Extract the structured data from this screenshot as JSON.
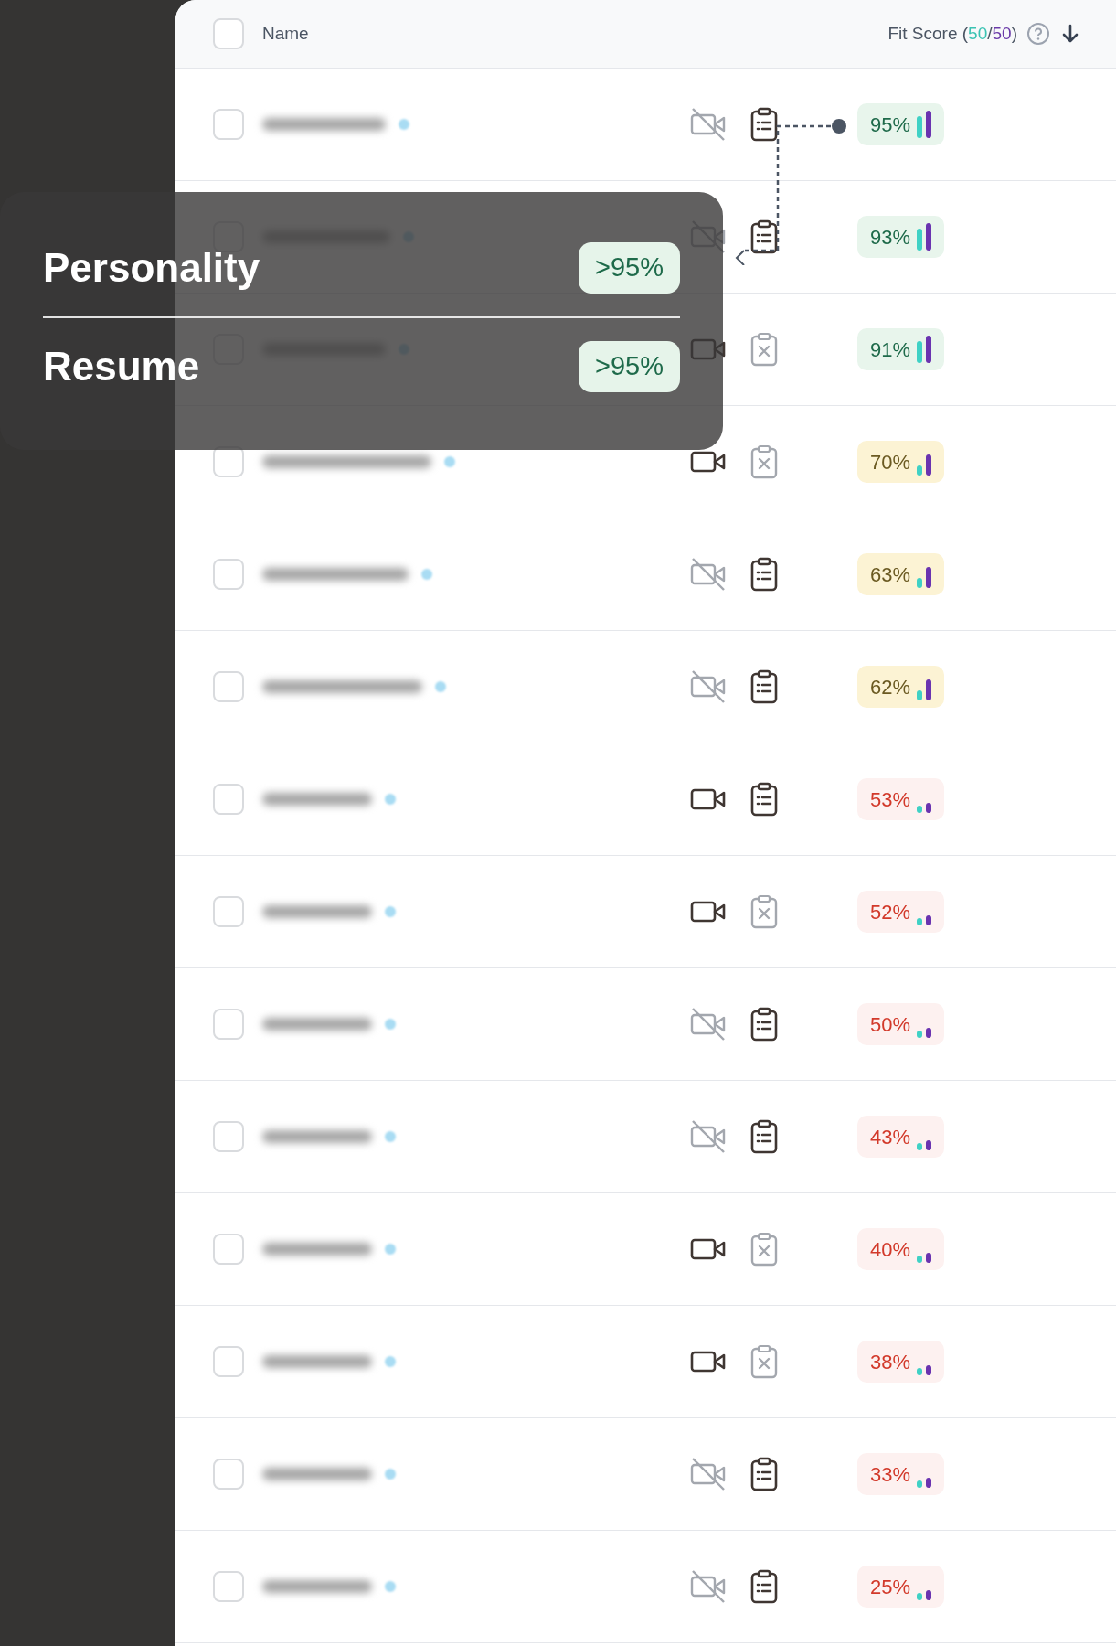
{
  "header": {
    "checked": false,
    "column_name": "Name",
    "fit_score": {
      "title": "Fit Score",
      "open": "(",
      "personality_max": "50",
      "separator": "/",
      "resume_max": "50",
      "close": ")"
    }
  },
  "rows": [
    {
      "checked": false,
      "video": false,
      "resume": true,
      "score": "95%",
      "kind": "high"
    },
    {
      "checked": false,
      "video": false,
      "resume": true,
      "score": "93%",
      "kind": "high"
    },
    {
      "checked": false,
      "video": true,
      "resume": false,
      "score": "91%",
      "kind": "high"
    },
    {
      "checked": false,
      "video": true,
      "resume": false,
      "score": "70%",
      "kind": "medium"
    },
    {
      "checked": false,
      "video": false,
      "resume": true,
      "score": "63%",
      "kind": "medium"
    },
    {
      "checked": false,
      "video": false,
      "resume": true,
      "score": "62%",
      "kind": "medium"
    },
    {
      "checked": false,
      "video": true,
      "resume": true,
      "score": "53%",
      "kind": "low"
    },
    {
      "checked": false,
      "video": true,
      "resume": false,
      "score": "52%",
      "kind": "low"
    },
    {
      "checked": false,
      "video": false,
      "resume": true,
      "score": "50%",
      "kind": "low"
    },
    {
      "checked": false,
      "video": false,
      "resume": true,
      "score": "43%",
      "kind": "low"
    },
    {
      "checked": false,
      "video": true,
      "resume": false,
      "score": "40%",
      "kind": "low"
    },
    {
      "checked": false,
      "video": true,
      "resume": false,
      "score": "38%",
      "kind": "low"
    },
    {
      "checked": false,
      "video": false,
      "resume": true,
      "score": "33%",
      "kind": "low"
    },
    {
      "checked": false,
      "video": false,
      "resume": true,
      "score": "25%",
      "kind": "low"
    }
  ],
  "tooltip": {
    "items": [
      {
        "label": "Personality",
        "value": ">95%"
      },
      {
        "label": "Resume",
        "value": ">95%"
      }
    ]
  }
}
